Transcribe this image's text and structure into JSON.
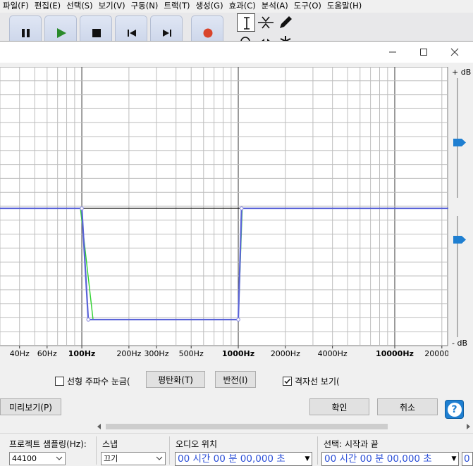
{
  "menu": [
    "파일(F)",
    "편집(E)",
    "선택(S)",
    "보기(V)",
    "구동(N)",
    "트랙(T)",
    "생성(G)",
    "효과(C)",
    "분석(A)",
    "도구(O)",
    "도움말(H)"
  ],
  "transport": [
    "pause-icon",
    "play-icon",
    "stop-icon",
    "skip-start-icon",
    "skip-end-icon",
    "record-icon"
  ],
  "tools": [
    "selection-tool-icon",
    "envelope-tool-icon",
    "draw-tool-icon"
  ],
  "colors": {
    "accent": "#1f7fd1",
    "curve_blue": "#5a63d8",
    "curve_green": "#2fd12f",
    "time_text": "#2b4fd8",
    "record": "#d9442b"
  },
  "dialog": {
    "db_top": "+ dB",
    "db_bottom": "- dB",
    "freq_axis": [
      {
        "label": "40Hz",
        "hz": 40,
        "bold": false
      },
      {
        "label": "60Hz",
        "hz": 60,
        "bold": false
      },
      {
        "label": "100Hz",
        "hz": 100,
        "bold": true
      },
      {
        "label": "200Hz",
        "hz": 200,
        "bold": false
      },
      {
        "label": "300Hz",
        "hz": 300,
        "bold": false
      },
      {
        "label": "500Hz",
        "hz": 500,
        "bold": false
      },
      {
        "label": "1000Hz",
        "hz": 1000,
        "bold": true
      },
      {
        "label": "2000Hz",
        "hz": 2000,
        "bold": false
      },
      {
        "label": "4000Hz",
        "hz": 4000,
        "bold": false
      },
      {
        "label": "10000Hz",
        "hz": 10000,
        "bold": true
      },
      {
        "label": "20000Hz",
        "hz": 20000,
        "bold": false
      }
    ],
    "linear_freq_label": "선형 주파수 눈금(",
    "linear_freq_checked": false,
    "flatten_label": "평탄화(T)",
    "invert_label": "반전(I)",
    "grid_label": "격자선 보기(",
    "grid_checked": true,
    "preview_label": "미리보기(P)",
    "ok_label": "확인",
    "cancel_label": "취소",
    "help_glyph": "?"
  },
  "chart_data": {
    "type": "line",
    "xscale": "log",
    "xlim": [
      30,
      22000
    ],
    "series": [
      {
        "points": [
          [
            30,
            0
          ],
          [
            100,
            0
          ],
          [
            110,
            -1
          ],
          [
            1000,
            -1
          ],
          [
            1050,
            0
          ],
          [
            22000,
            0
          ]
        ]
      },
      {
        "points": [
          [
            30,
            0
          ],
          [
            98,
            0
          ],
          [
            118,
            -1
          ],
          [
            1000,
            -1
          ],
          [
            1060,
            0
          ],
          [
            22000,
            0
          ]
        ]
      },
      {
        "points": [
          [
            30,
            0
          ],
          [
            22000,
            0
          ]
        ]
      }
    ]
  },
  "bottom": {
    "rate_label": "프로젝트 샘플링(Hz):",
    "rate_value": "44100",
    "snap_label": "스냅",
    "snap_value": "끄기",
    "audio_pos_label": "오디오 위치",
    "audio_pos_value": "00 시간 00 분 00,000 초",
    "selection_label": "선택: 시작과 끝",
    "selection_start_value": "00 시간 00 분 00,000 초",
    "selection_end_value": "0"
  }
}
